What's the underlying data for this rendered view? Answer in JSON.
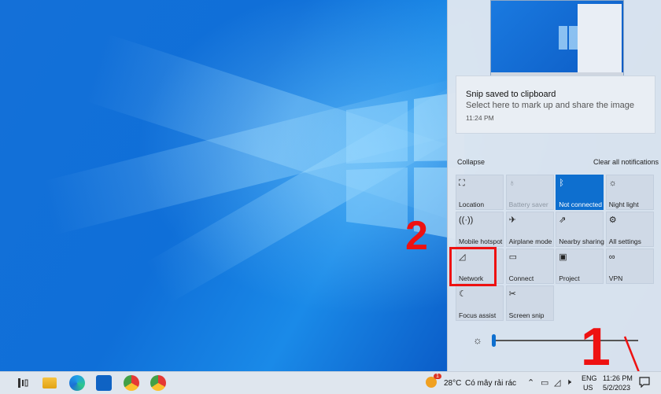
{
  "notification": {
    "title": "Snip saved to clipboard",
    "body": "Select here to mark up and share the image",
    "time": "11:24 PM"
  },
  "action_center": {
    "collapse_label": "Collapse",
    "clear_label": "Clear all notifications",
    "tiles": [
      {
        "label": "Location",
        "icon": "location-icon",
        "glyph": "⛶",
        "state": "normal"
      },
      {
        "label": "Battery saver",
        "icon": "battery-saver-icon",
        "glyph": "♁",
        "state": "disabled"
      },
      {
        "label": "Not connected",
        "icon": "bluetooth-icon",
        "glyph": "ᛒ",
        "state": "active"
      },
      {
        "label": "Night light",
        "icon": "night-light-icon",
        "glyph": "☼",
        "state": "normal"
      },
      {
        "label": "Mobile hotspot",
        "icon": "mobile-hotspot-icon",
        "glyph": "((·))",
        "state": "normal"
      },
      {
        "label": "Airplane mode",
        "icon": "airplane-icon",
        "glyph": "✈",
        "state": "normal"
      },
      {
        "label": "Nearby sharing",
        "icon": "nearby-sharing-icon",
        "glyph": "⇗",
        "state": "normal"
      },
      {
        "label": "All settings",
        "icon": "settings-icon",
        "glyph": "⚙",
        "state": "normal"
      },
      {
        "label": "Network",
        "icon": "network-icon",
        "glyph": "◿",
        "state": "normal"
      },
      {
        "label": "Connect",
        "icon": "connect-icon",
        "glyph": "▭",
        "state": "normal"
      },
      {
        "label": "Project",
        "icon": "project-icon",
        "glyph": "▣",
        "state": "normal"
      },
      {
        "label": "VPN",
        "icon": "vpn-icon",
        "glyph": "∞",
        "state": "normal"
      },
      {
        "label": "Focus assist",
        "icon": "focus-assist-icon",
        "glyph": "☾",
        "state": "normal"
      },
      {
        "label": "Screen snip",
        "icon": "screen-snip-icon",
        "glyph": "✂",
        "state": "normal"
      }
    ],
    "brightness": 0.0
  },
  "annotations": {
    "step1": "1",
    "step2": "2"
  },
  "taskbar": {
    "weather_temp": "28°C",
    "weather_desc": "Có mây rải rác",
    "weather_badge": "1",
    "lang_top": "ENG",
    "lang_bottom": "US",
    "time": "11:26 PM",
    "date": "5/2/2023"
  },
  "colors": {
    "accent": "#0e6fcf",
    "annotation": "#e11111"
  }
}
